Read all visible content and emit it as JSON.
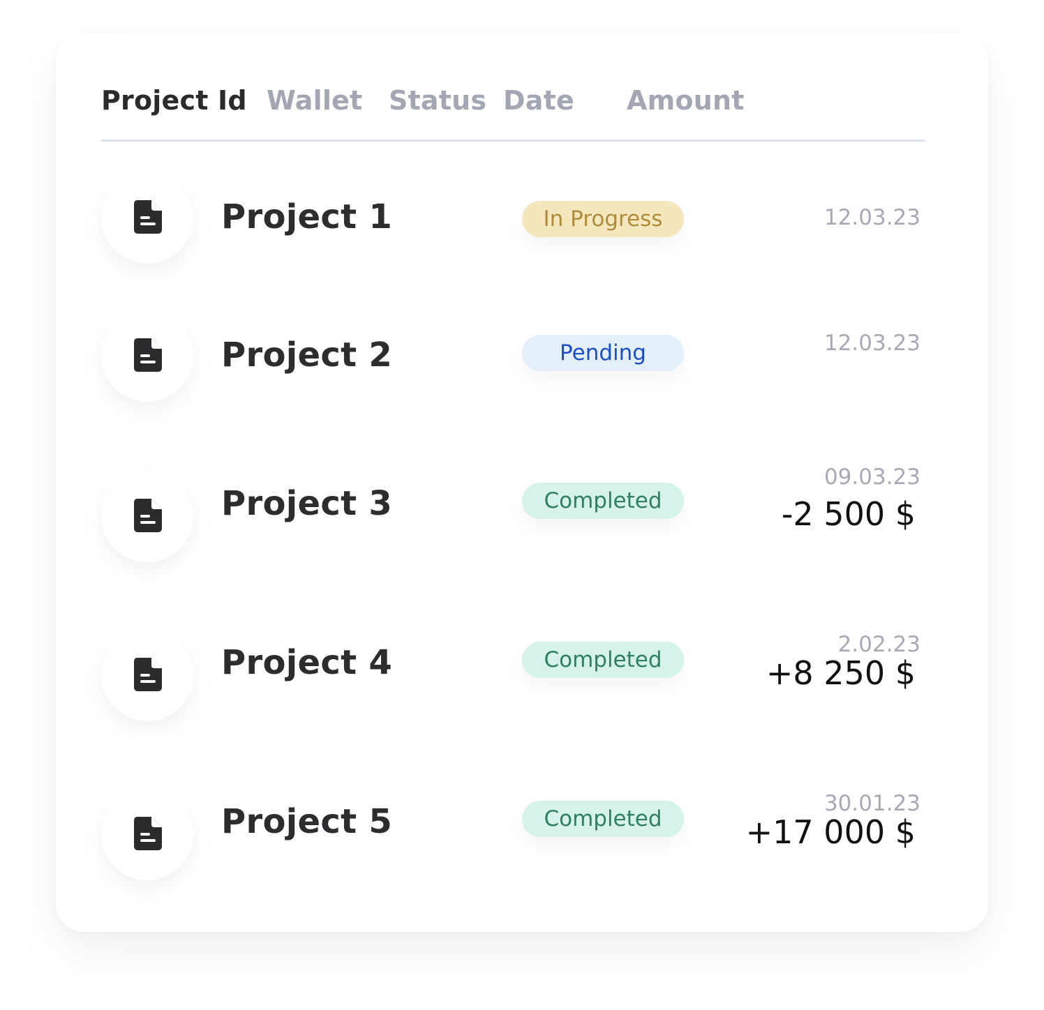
{
  "table": {
    "headers": [
      {
        "label": "Project Id",
        "active": true
      },
      {
        "label": "Wallet",
        "active": false
      },
      {
        "label": "Status",
        "active": false
      },
      {
        "label": "Date",
        "active": false
      },
      {
        "label": "Amount",
        "active": false
      }
    ],
    "rows": [
      {
        "icon": "document-icon",
        "name": "Project 1",
        "status": "In Progress",
        "status_type": "in-progress",
        "date": "12.03.23",
        "amount": ""
      },
      {
        "icon": "document-icon",
        "name": "Project 2",
        "status": "Pending",
        "status_type": "pending",
        "date": "12.03.23",
        "amount": ""
      },
      {
        "icon": "document-icon",
        "name": "Project 3",
        "status": "Completed",
        "status_type": "completed",
        "date": "09.03.23",
        "amount": "-2 500 $"
      },
      {
        "icon": "document-icon",
        "name": "Project 4",
        "status": "Completed",
        "status_type": "completed",
        "date": "2.02.23",
        "amount": "+8 250 $"
      },
      {
        "icon": "document-icon",
        "name": "Project 5",
        "status": "Completed",
        "status_type": "completed",
        "date": "30.01.23",
        "amount": "+17 000 $"
      }
    ]
  },
  "colors": {
    "in_progress_bg": "#f5e7bd",
    "in_progress_text": "#ad8c3c",
    "pending_bg": "#e3effb",
    "pending_text": "#1e4fc2",
    "completed_bg": "#d5f3ea",
    "completed_text": "#2f7f61",
    "header_active": "#2b2b2e",
    "header_inactive": "#a3a6b3"
  }
}
